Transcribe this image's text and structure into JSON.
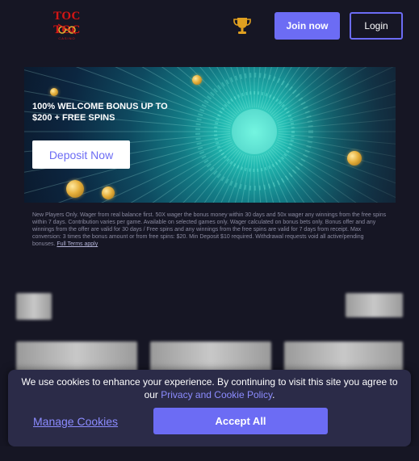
{
  "header": {
    "logo_text": "TOC TOC",
    "logo_sub": "CASINO",
    "join_label": "Join now",
    "login_label": "Login"
  },
  "hero": {
    "title_line1": "100% WELCOME BONUS UP TO",
    "title_line2": "$200 + FREE SPINS",
    "deposit_label": "Deposit Now"
  },
  "terms": {
    "text": "New Players Only. Wager from real balance first. 50X wager the bonus money within 30 days and 50x wager any winnings from the free spins within 7 days. Contribution varies per game. Available on selected games only. Wager calculated on bonus bets only. Bonus offer and any winnings from the offer are valid for 30 days / Free spins and any winnings from the free spins are valid for 7 days from receipt. Max conversion: 3 times the bonus amount or from free spins: $20. Min Deposit $10 required. Withdrawal requests void all active/pending bonuses.",
    "link_label": "Full Terms apply"
  },
  "cookie": {
    "text_before": "We use cookies to enhance your experience. By continuing to visit this site you agree to our ",
    "policy_link": "Privacy and Cookie Policy",
    "text_after": ".",
    "manage_label": "Manage Cookies",
    "accept_label": "Accept All"
  },
  "icons": {
    "trophy": "trophy-icon",
    "logo_mark": "glasses-logo-icon"
  },
  "colors": {
    "background": "#161624",
    "accent": "#6c6cf4",
    "logo_red": "#d01818",
    "trophy_gold": "#e0a020",
    "cookie_panel": "#2b2b48",
    "link": "#8c8cff"
  }
}
